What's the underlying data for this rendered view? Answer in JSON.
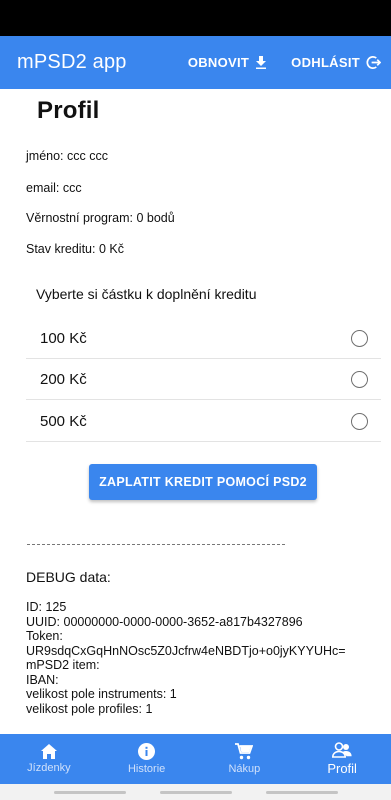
{
  "app": {
    "title": "mPSD2 app",
    "refresh_label": "OBNOVIT",
    "logout_label": "ODHLÁSIT"
  },
  "page": {
    "title": "Profil"
  },
  "profile": {
    "name_line": "jméno: ccc ccc",
    "email_line": "email: ccc",
    "loyalty_line": "Věrnostní program: 0 bodů",
    "credit_line": "Stav kreditu: 0 Kč"
  },
  "credit": {
    "prompt": "Vyberte si částku k doplnění kreditu",
    "options": [
      {
        "label": "100 Kč",
        "selected": false
      },
      {
        "label": "200 Kč",
        "selected": false
      },
      {
        "label": "500 Kč",
        "selected": false
      }
    ],
    "pay_button": "ZAPLATIT KREDIT POMOCÍ PSD2"
  },
  "debug": {
    "title": "DEBUG data:",
    "lines": [
      "ID: 125",
      "UUID: 00000000-0000-0000-3652-a817b4327896",
      "Token:",
      "UR9sdqCxGqHnNOsc5Z0Jcfrw4eNBDTjo+o0jyKYYUHc=",
      "mPSD2 item:",
      "IBAN:",
      "velikost pole instruments: 1",
      "velikost pole profiles: 1"
    ]
  },
  "nav": {
    "items": [
      {
        "label": "Jízdenky",
        "icon": "home-icon",
        "active": false
      },
      {
        "label": "Historie",
        "icon": "info-icon",
        "active": false
      },
      {
        "label": "Nákup",
        "icon": "cart-icon",
        "active": false
      },
      {
        "label": "Profil",
        "icon": "people-icon",
        "active": true
      }
    ]
  },
  "colors": {
    "primary": "#3a86ee",
    "status_bar": "#000000"
  }
}
